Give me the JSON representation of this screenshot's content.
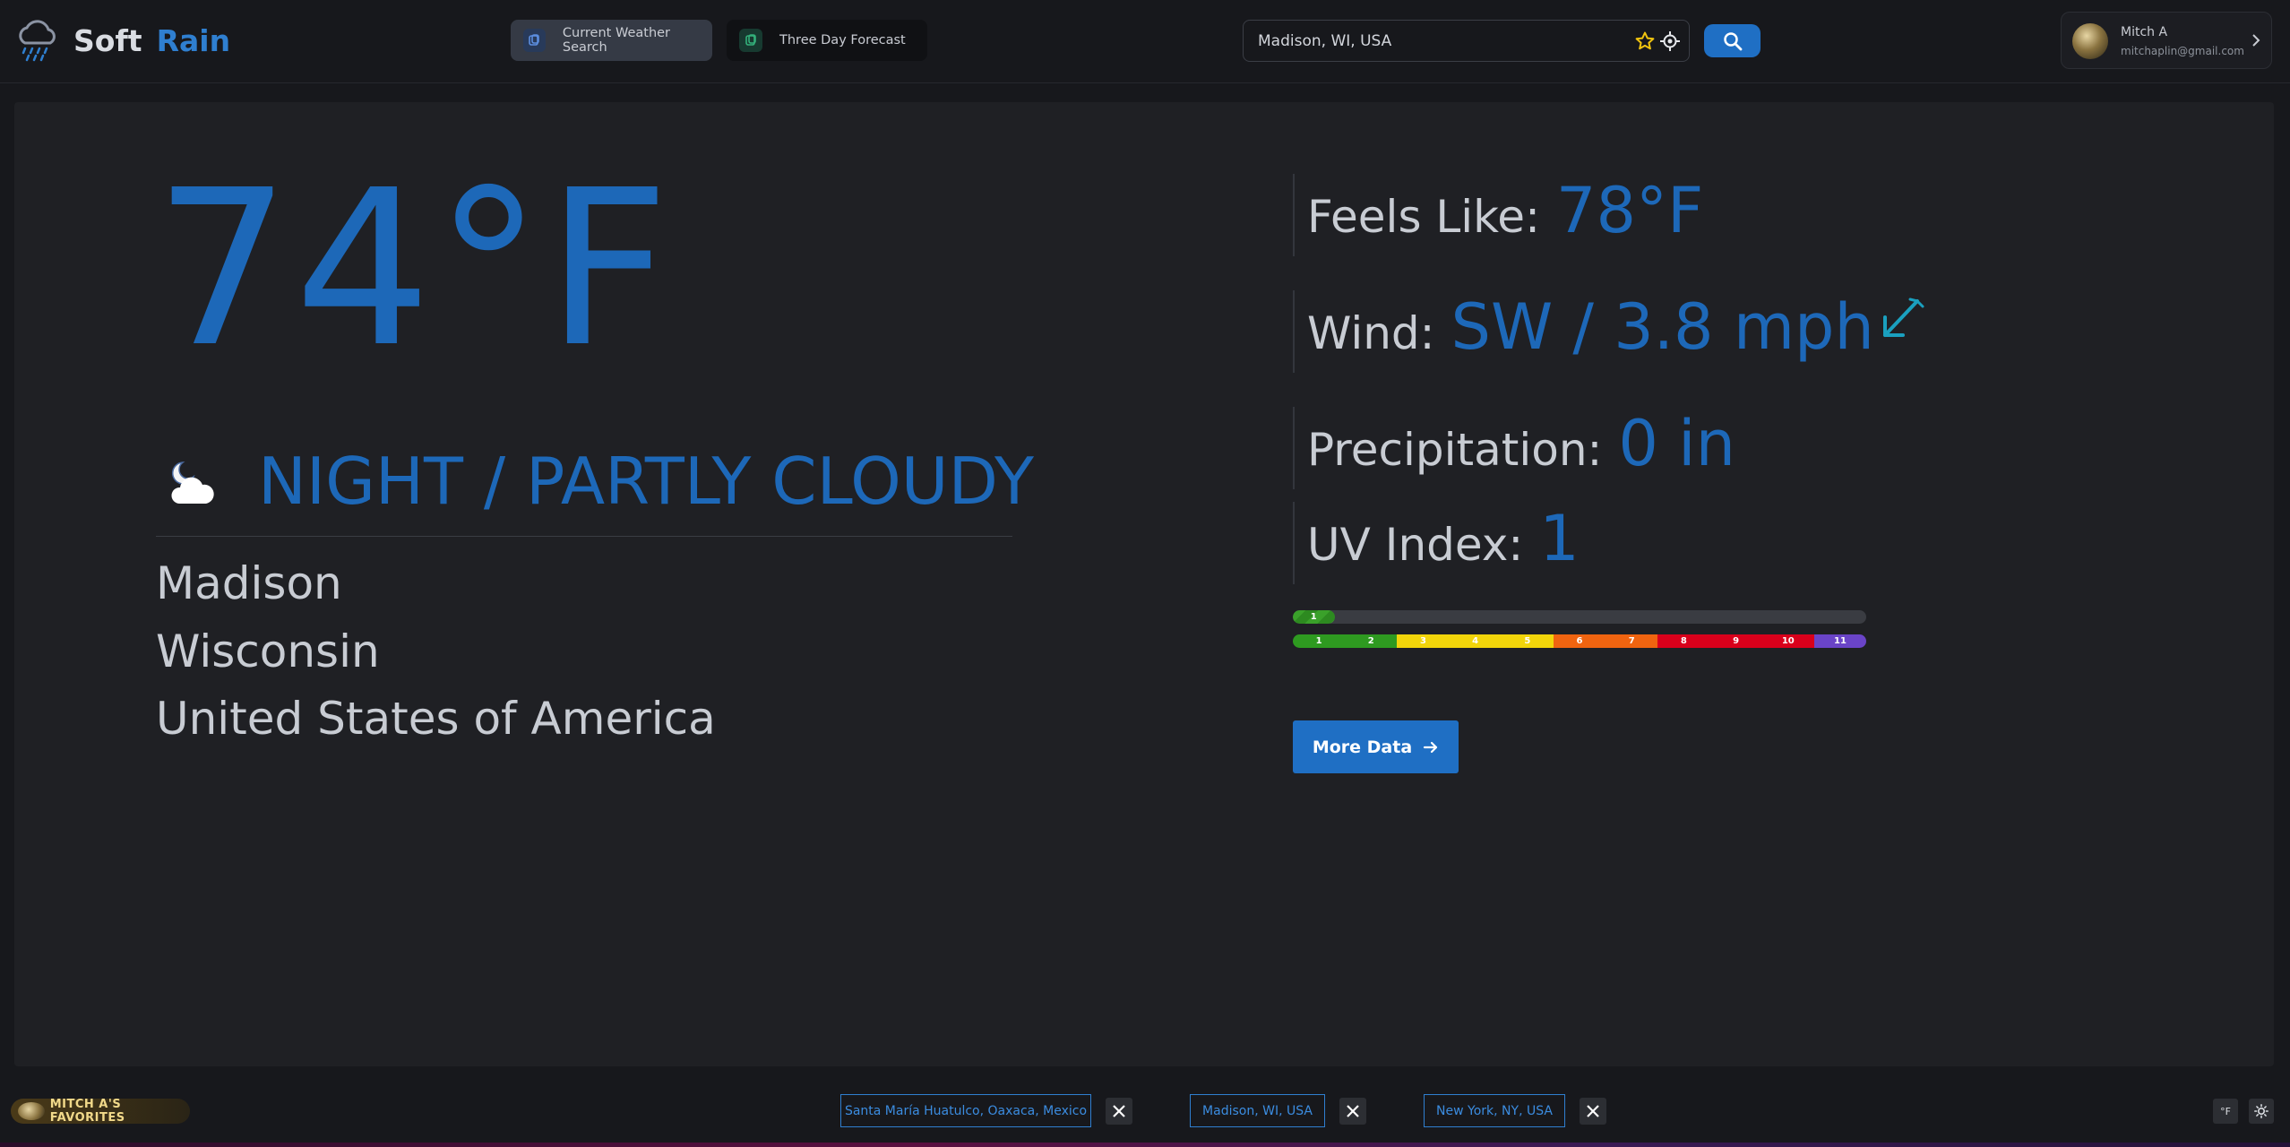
{
  "header": {
    "logo_word1": "Soft",
    "logo_word2": "Rain",
    "tabs": [
      {
        "label": "Current Weather Search",
        "active": true
      },
      {
        "label": "Three Day Forecast",
        "active": false
      }
    ],
    "search": {
      "value": "Madison, WI, USA"
    },
    "user": {
      "name": "Mitch A",
      "email": "mitchaplin@gmail.com"
    }
  },
  "current": {
    "temperature": "74°F",
    "condition": "NIGHT / PARTLY CLOUDY",
    "location": {
      "city": "Madison",
      "state": "Wisconsin",
      "country": "United States of America"
    },
    "feels_like": {
      "label": "Feels Like:",
      "value": "78°F"
    },
    "wind": {
      "label": "Wind:",
      "value": "SW / 3.8 mph"
    },
    "precipitation": {
      "label": "Precipitation:",
      "value": "0 in"
    },
    "uv": {
      "label": "UV Index:",
      "value": "1",
      "level": 1,
      "max": 11,
      "fill_text": "1"
    },
    "uv_scale": [
      {
        "n": "1",
        "color": "#2e9a20"
      },
      {
        "n": "2",
        "color": "#2e9a20"
      },
      {
        "n": "3",
        "color": "#f2d50a"
      },
      {
        "n": "4",
        "color": "#f2d50a"
      },
      {
        "n": "5",
        "color": "#f2d50a"
      },
      {
        "n": "6",
        "color": "#f06410"
      },
      {
        "n": "7",
        "color": "#f06410"
      },
      {
        "n": "8",
        "color": "#d9001b"
      },
      {
        "n": "9",
        "color": "#d9001b"
      },
      {
        "n": "10",
        "color": "#d9001b"
      },
      {
        "n": "11",
        "color": "#6a44c8"
      }
    ],
    "more_button": "More Data"
  },
  "footer": {
    "favorites_label": "MITCH A'S FAVORITES",
    "favorites": [
      "Santa María Huatulco, Oaxaca, Mexico",
      "Madison, WI, USA",
      "New York, NY, USA"
    ],
    "unit_toggle": "°F"
  },
  "colors": {
    "accent": "#1d68b8",
    "button": "#1f6fc4",
    "background": "#17181c",
    "panel": "#1f2024"
  }
}
